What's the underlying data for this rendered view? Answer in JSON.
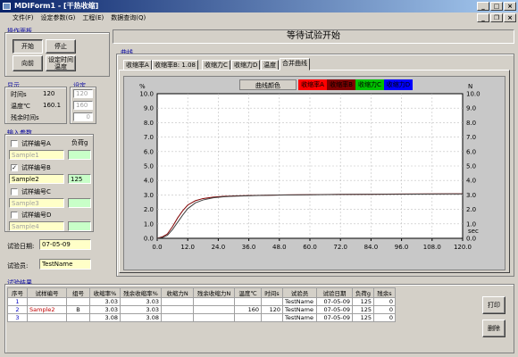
{
  "window": {
    "title": "MDIForm1 - [干热收缩]"
  },
  "menu": [
    "文件(F)",
    "设定参数(G)",
    "工程(E)",
    "数据查询(Q)"
  ],
  "ops": {
    "group": "操作面板",
    "start": "开始",
    "stop": "停止",
    "forward": "向前",
    "set_time": "设定时间温度"
  },
  "display": {
    "group": "显示",
    "set_group": "设定",
    "rows": [
      {
        "label": "时间s",
        "value": "120",
        "set": "120"
      },
      {
        "label": "温度℃",
        "value": "160.1",
        "set": "160"
      },
      {
        "label": "残余时间s",
        "value": "",
        "set": "0"
      }
    ]
  },
  "input": {
    "group": "输入参数",
    "load_label": "负荷g",
    "samples": [
      {
        "label": "试样编号A",
        "checked": false,
        "name": "Sample1",
        "load": ""
      },
      {
        "label": "试样编号B",
        "checked": true,
        "name": "Sample2",
        "load": "125"
      },
      {
        "label": "试样编号C",
        "checked": false,
        "name": "Sample3",
        "load": ""
      },
      {
        "label": "试样编号D",
        "checked": false,
        "name": "Sample4",
        "load": ""
      }
    ],
    "date_label": "试验日期:",
    "date_value": "07-05-09",
    "tester_label": "试验员:",
    "tester_value": "TestName"
  },
  "status": "等待试验开始",
  "curve": {
    "group": "曲线",
    "tabs": [
      "收缩率A",
      "收缩率B: 1.08",
      "收缩力C",
      "收缩力D",
      "温度",
      "合并曲线"
    ],
    "active_tab": 5,
    "legend_label": "曲线颜色",
    "legend": [
      {
        "name": "收缩率A",
        "color": "#ff0000"
      },
      {
        "name": "收缩率B",
        "color": "#800000"
      },
      {
        "name": "收缩力C",
        "color": "#00c000"
      },
      {
        "name": "收缩力D",
        "color": "#0000ff"
      }
    ]
  },
  "chart_data": {
    "type": "line",
    "y_unit_left": "%",
    "y_unit_right": "N",
    "x_unit": "sec",
    "xlim": [
      0,
      120
    ],
    "ylim": [
      0,
      10
    ],
    "xticks": [
      "0.0",
      "12.0",
      "24.0",
      "36.0",
      "48.0",
      "60.0",
      "72.0",
      "84.0",
      "96.0",
      "108.0",
      "120.0"
    ],
    "yticks": [
      "0.0",
      "1.0",
      "2.0",
      "3.0",
      "4.0",
      "5.0",
      "6.0",
      "7.0",
      "8.0",
      "9.0",
      "10.0"
    ],
    "grid": true,
    "series": [
      {
        "color": "#800000",
        "x": [
          0,
          2,
          4,
          6,
          8,
          10,
          12,
          15,
          18,
          22,
          26,
          30,
          40,
          50,
          60,
          72,
          84,
          96,
          108,
          120
        ],
        "y": [
          0,
          0.1,
          0.3,
          0.8,
          1.4,
          1.9,
          2.3,
          2.6,
          2.75,
          2.85,
          2.9,
          2.93,
          2.97,
          3.0,
          3.02,
          3.04,
          3.05,
          3.06,
          3.07,
          3.08
        ]
      },
      {
        "color": "#404040",
        "x": [
          0,
          2,
          4,
          6,
          8,
          10,
          12,
          15,
          18,
          22,
          26,
          30,
          40,
          50,
          60,
          72,
          84,
          96,
          108,
          120
        ],
        "y": [
          0,
          0.05,
          0.2,
          0.6,
          1.1,
          1.6,
          2.05,
          2.45,
          2.65,
          2.8,
          2.87,
          2.91,
          2.96,
          2.99,
          3.01,
          3.03,
          3.04,
          3.05,
          3.06,
          3.07
        ]
      }
    ]
  },
  "results": {
    "group": "试验结果",
    "columns": [
      "序号",
      "试样编号",
      "组号",
      "收缩率%",
      "残余收缩率%",
      "收缩力N",
      "残余收缩力N",
      "温度℃",
      "时间s",
      "试验员",
      "试验日期",
      "负荷g",
      "残余s"
    ],
    "rows": [
      [
        "1",
        "",
        "",
        "3.03",
        "3.03",
        "",
        "",
        "",
        "",
        "TestName",
        "07-05-09",
        "125",
        "0"
      ],
      [
        "2",
        "Sample2",
        "B",
        "3.03",
        "3.03",
        "",
        "",
        "160",
        "120",
        "TestName",
        "07-05-09",
        "125",
        "0"
      ],
      [
        "3",
        "",
        "",
        "3.08",
        "3.08",
        "",
        "",
        "",
        "",
        "TestName",
        "07-05-09",
        "125",
        "0"
      ]
    ],
    "print": "打印",
    "delete": "删除"
  }
}
